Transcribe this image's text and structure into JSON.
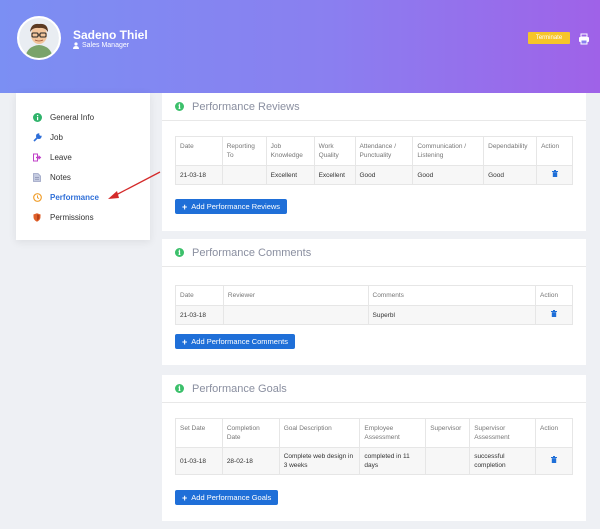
{
  "profile": {
    "name": "Sadeno Thiel",
    "role": "Sales Manager",
    "terminate_label": "Terminate"
  },
  "sidebar": {
    "items": [
      {
        "label": "General Info",
        "icon": "info-circle-icon",
        "color": "#2fb36b"
      },
      {
        "label": "Job",
        "icon": "wrench-icon",
        "color": "#2f6fd8"
      },
      {
        "label": "Leave",
        "icon": "sign-out-icon",
        "color": "#c040c8"
      },
      {
        "label": "Notes",
        "icon": "document-icon",
        "color": "#9aa3c4"
      },
      {
        "label": "Performance",
        "icon": "clock-icon",
        "color": "#f0a030",
        "active": true
      },
      {
        "label": "Permissions",
        "icon": "shield-icon",
        "color": "#e0602a"
      }
    ]
  },
  "reviews": {
    "title": "Performance Reviews",
    "headers": [
      "Date",
      "Reporting To",
      "Job Knowledge",
      "Work Quality",
      "Attendance / Punctuality",
      "Communication / Listening",
      "Dependability",
      "Action"
    ],
    "rows": [
      [
        "21-03-18",
        "",
        "Excellent",
        "Excellent",
        "Good",
        "Good",
        "Good"
      ]
    ],
    "add_label": "Add Performance Reviews"
  },
  "comments": {
    "title": "Performance Comments",
    "headers": [
      "Date",
      "Reviewer",
      "Comments",
      "Action"
    ],
    "rows": [
      [
        "21-03-18",
        "",
        "Superbl"
      ]
    ],
    "add_label": "Add Performance Comments"
  },
  "goals": {
    "title": "Performance Goals",
    "headers": [
      "Set Date",
      "Completion Date",
      "Goal Description",
      "Employee Assessment",
      "Supervisor",
      "Supervisor Assessment",
      "Action"
    ],
    "rows": [
      [
        "01-03-18",
        "28-02-18",
        "Complete web design in 3 weeks",
        "completed in 11 days",
        "",
        "successful completion"
      ]
    ],
    "add_label": "Add Performance Goals"
  },
  "colors": {
    "accent": "#1f6fd8",
    "terminate": "#f6c52a",
    "annotation_arrow": "#d42a2a"
  }
}
